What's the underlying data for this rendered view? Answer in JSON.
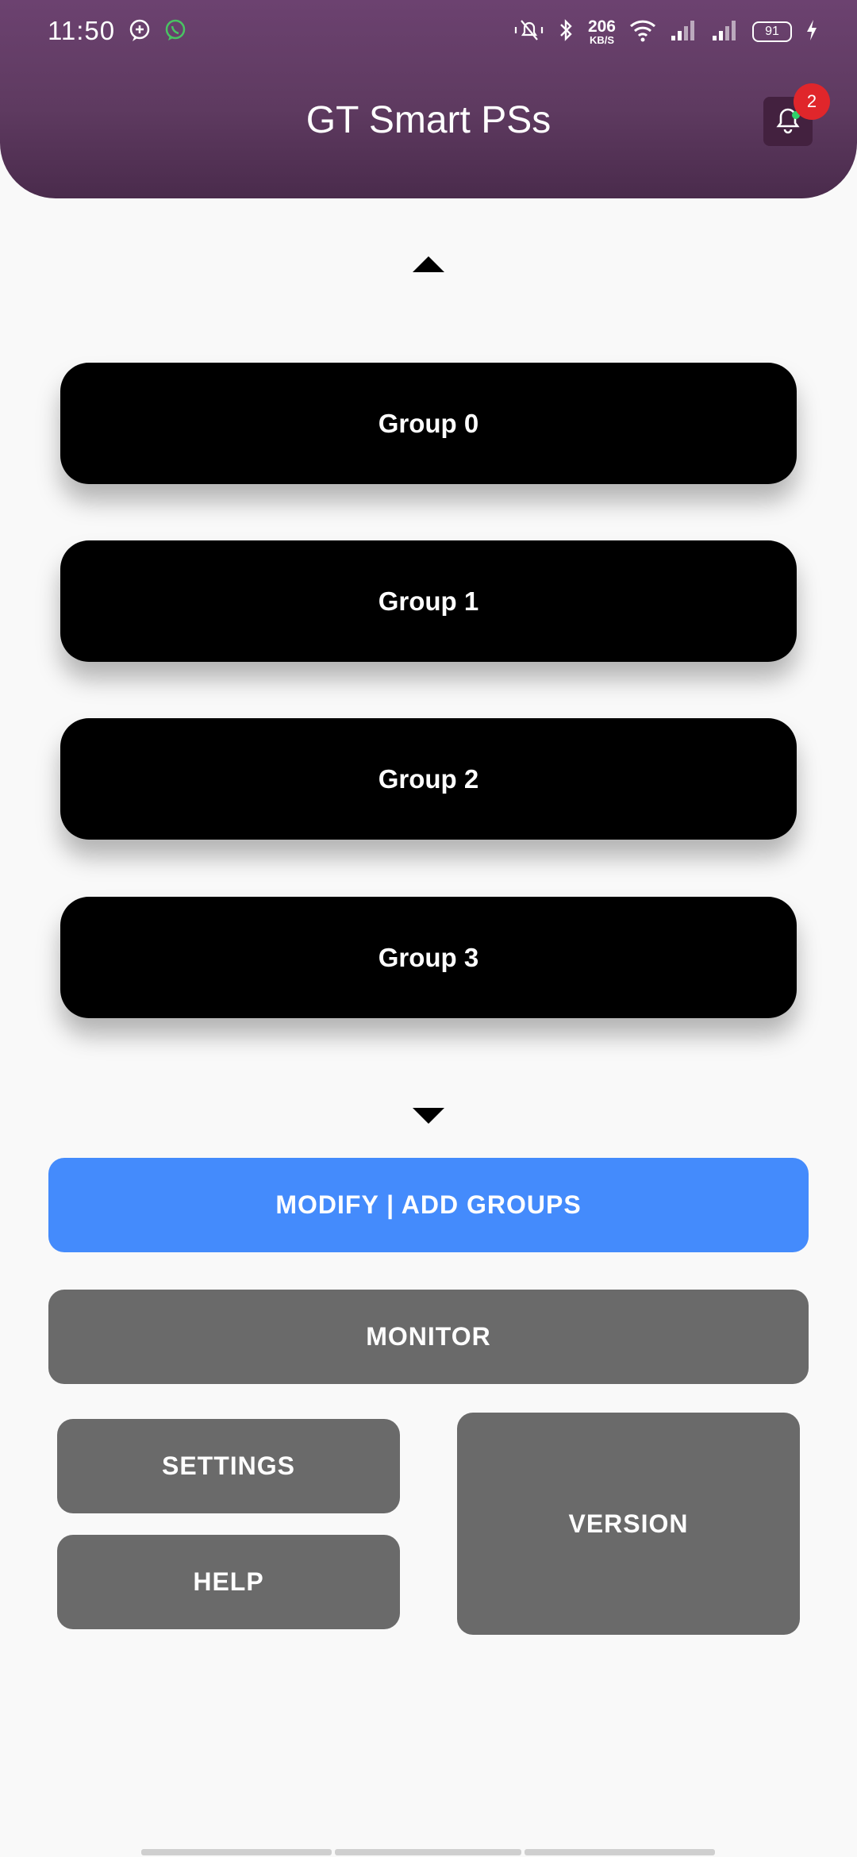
{
  "status_bar": {
    "time": "11:50",
    "net_speed_value": "206",
    "net_speed_unit": "KB/S",
    "battery": "91",
    "icons": [
      "chat-bubble-icon",
      "whatsapp-icon",
      "mute-bell-icon",
      "bluetooth-icon",
      "wifi-icon",
      "signal-icon",
      "signal-icon",
      "battery-icon",
      "charging-icon"
    ]
  },
  "header": {
    "title": "GT Smart PSs",
    "notification_count": "2"
  },
  "groups": [
    {
      "label": "Group 0"
    },
    {
      "label": "Group 1"
    },
    {
      "label": "Group 2"
    },
    {
      "label": "Group 3"
    }
  ],
  "actions": {
    "modify": "MODIFY | ADD GROUPS",
    "monitor": "MONITOR",
    "settings": "SETTINGS",
    "help": "HELP",
    "version": "VERSION"
  },
  "colors": {
    "header": "#5e3a60",
    "primary_button": "#448bfc",
    "secondary_button": "#6a6a6a",
    "group_button": "#000000",
    "badge": "#e0262b"
  }
}
